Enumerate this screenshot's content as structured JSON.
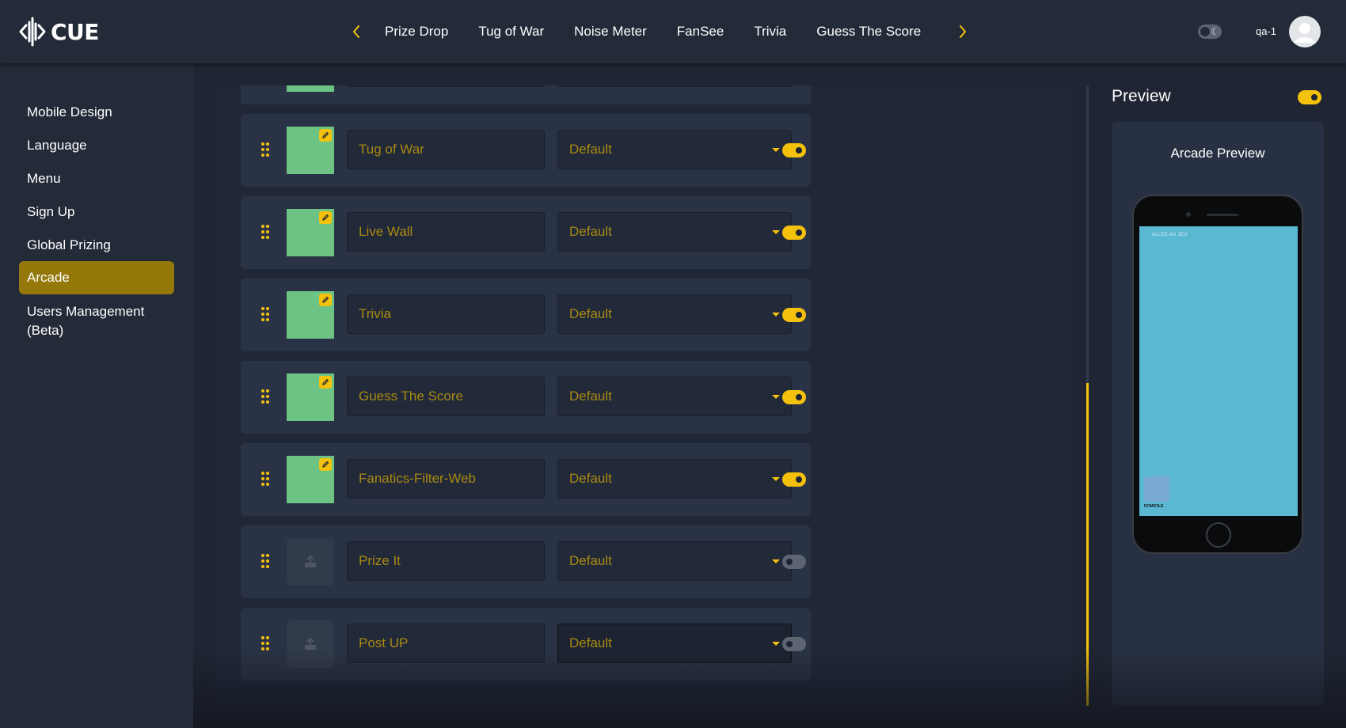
{
  "app": {
    "brand": "CUE"
  },
  "topnav": {
    "tabs": [
      "Prize Drop",
      "Tug of War",
      "Noise Meter",
      "FanSee",
      "Trivia",
      "Guess The Score"
    ],
    "user": "qa-1"
  },
  "sidebar": {
    "items": [
      {
        "label": "Mobile Design"
      },
      {
        "label": "Language"
      },
      {
        "label": "Menu"
      },
      {
        "label": "Sign Up"
      },
      {
        "label": "Global Prizing"
      },
      {
        "label": "Arcade",
        "active": true
      },
      {
        "label": "Users Management (Beta)"
      }
    ]
  },
  "arcade": {
    "rows": [
      {
        "name": "Tug of War",
        "option": "Default",
        "enabled": true,
        "has_image": true
      },
      {
        "name": "Live Wall",
        "option": "Default",
        "enabled": true,
        "has_image": true
      },
      {
        "name": "Trivia",
        "option": "Default",
        "enabled": true,
        "has_image": true
      },
      {
        "name": "Guess The Score",
        "option": "Default",
        "enabled": true,
        "has_image": true
      },
      {
        "name": "Fanatics-Filter-Web",
        "option": "Default",
        "enabled": true,
        "has_image": true
      },
      {
        "name": "Prize It",
        "option": "Default",
        "enabled": false,
        "has_image": false
      },
      {
        "name": "Post UP",
        "option": "Default",
        "enabled": false,
        "has_image": false
      }
    ]
  },
  "preview": {
    "title": "Preview",
    "enabled": true,
    "card_title": "Arcade Preview",
    "screen_header": "ALLEZ AU JEU",
    "tile_label": "DOMICILE"
  },
  "colors": {
    "accent": "#f4c20d",
    "active_nav": "#95780a",
    "thumbnail": "#6cc384",
    "phone_screen": "#5bb8d3"
  },
  "icons": [
    "chevron-left-icon",
    "chevron-right-icon",
    "theme-moon-icon",
    "user-avatar-icon",
    "drag-handle-icon",
    "pencil-icon",
    "upload-icon",
    "caret-down-icon"
  ]
}
